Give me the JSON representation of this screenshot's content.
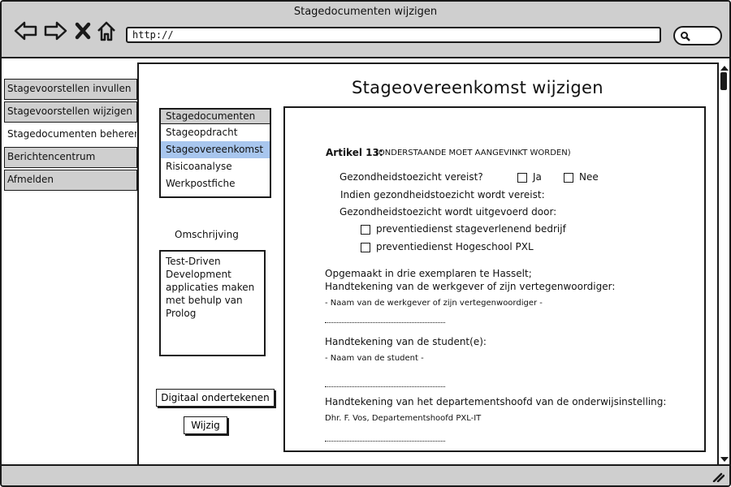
{
  "window": {
    "title": "Stagedocumenten wijzigen"
  },
  "browser": {
    "url": "http://"
  },
  "nav": {
    "items": [
      {
        "label": "Stagevoorstellen invullen",
        "active": false
      },
      {
        "label": "Stagevoorstellen wijzigen",
        "active": false
      },
      {
        "label": "Stagedocumenten beheren",
        "active": true
      },
      {
        "label": "Berichtencentrum",
        "active": false
      },
      {
        "label": "Afmelden",
        "active": false
      }
    ]
  },
  "page": {
    "title": "Stageovereenkomst wijzigen"
  },
  "documents": {
    "header": "Stagedocumenten",
    "items": [
      "Stageopdracht",
      "Stageovereenkomst",
      "Risicoanalyse",
      "Werkpostfiche"
    ],
    "selected": "Stageovereenkomst"
  },
  "description": {
    "label": "Omschrijving",
    "text": "Test-Driven\nDevelopment\napplicaties maken\nmet behulp van\nProlog"
  },
  "buttons": {
    "sign": "Digitaal ondertekenen",
    "edit": "Wijzig"
  },
  "article": {
    "heading": "Artikel 13:",
    "note": "(ONDERSTAANDE MOET AANGEVINKT WORDEN)",
    "question": "Gezondheidstoezicht vereist?",
    "yes": "Ja",
    "no": "Nee",
    "line1": "Indien gezondheidstoezicht wordt vereist:",
    "line2": "Gezondheidstoezicht wordt uitgevoerd door:",
    "option1": "preventiedienst stageverlenend bedrijf",
    "option2": "preventiedienst Hogeschool PXL"
  },
  "signatures": {
    "place": "Opgemaakt in drie exemplaren te Hasselt;",
    "employer_heading": "Handtekening van de werkgever of zijn vertegenwoordiger:",
    "employer_name": "- Naam van de werkgever of zijn vertegenwoordiger -",
    "student_heading": "Handtekening van de student(e):",
    "student_name": "- Naam van de student -",
    "head_heading": "Handtekening van het departementshoofd van de onderwijsinstelling:",
    "head_name": "Dhr. F. Vos, Departementshoofd PXL-IT"
  },
  "colors": {
    "chrome": "#cfcfcf",
    "selection": "#a8c6ee",
    "ink": "#1a1a1a"
  }
}
